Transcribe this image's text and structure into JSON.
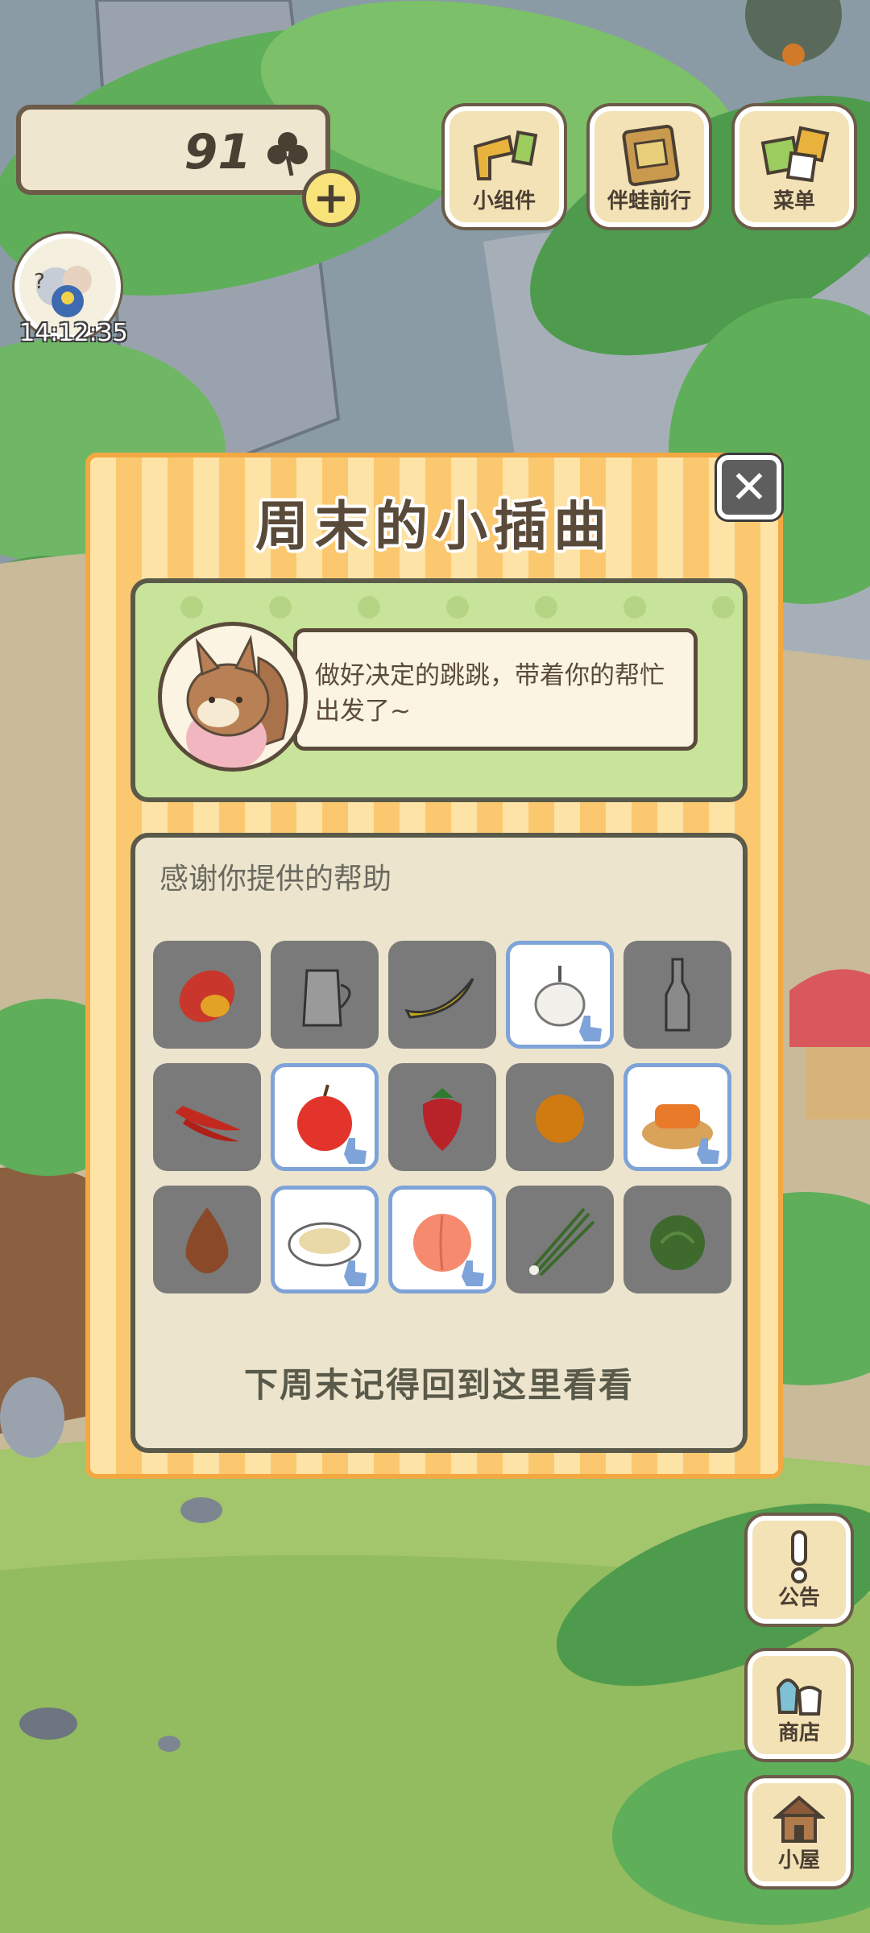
{
  "hud": {
    "clover_count": "91",
    "plus_label": "+",
    "clock_time": "14:12:35"
  },
  "top_menu": {
    "widgets_label": "小组件",
    "travel_label": "伴蛙前行",
    "menu_label": "菜单"
  },
  "side_menu": {
    "notice_label": "公告",
    "shop_label": "商店",
    "house_label": "小屋"
  },
  "modal": {
    "title": "周末的小插曲",
    "close_label": "✕",
    "speech": "做好决定的跳跳，带着你的帮忙出发了~",
    "thanks_label": "感谢你提供的帮助",
    "footer": "下周末记得回到这里看看",
    "items": [
      {
        "name": "mango",
        "selected": false
      },
      {
        "name": "milk-jug",
        "selected": false
      },
      {
        "name": "banana",
        "selected": false
      },
      {
        "name": "garlic",
        "selected": true
      },
      {
        "name": "bottle",
        "selected": false
      },
      {
        "name": "chili-peppers",
        "selected": false
      },
      {
        "name": "apple",
        "selected": true
      },
      {
        "name": "strawberry",
        "selected": false
      },
      {
        "name": "orange",
        "selected": false
      },
      {
        "name": "fried-dough-platter",
        "selected": true
      },
      {
        "name": "onion",
        "selected": false
      },
      {
        "name": "dumplings-bowl",
        "selected": true
      },
      {
        "name": "peach",
        "selected": true
      },
      {
        "name": "green-onion",
        "selected": false
      },
      {
        "name": "cabbage",
        "selected": false
      }
    ]
  },
  "colors": {
    "modal_stripe_light": "#fde3a6",
    "modal_stripe_dark": "#fbc870",
    "panel_green": "#c8e39a",
    "selected_border": "#7ea3d8"
  }
}
